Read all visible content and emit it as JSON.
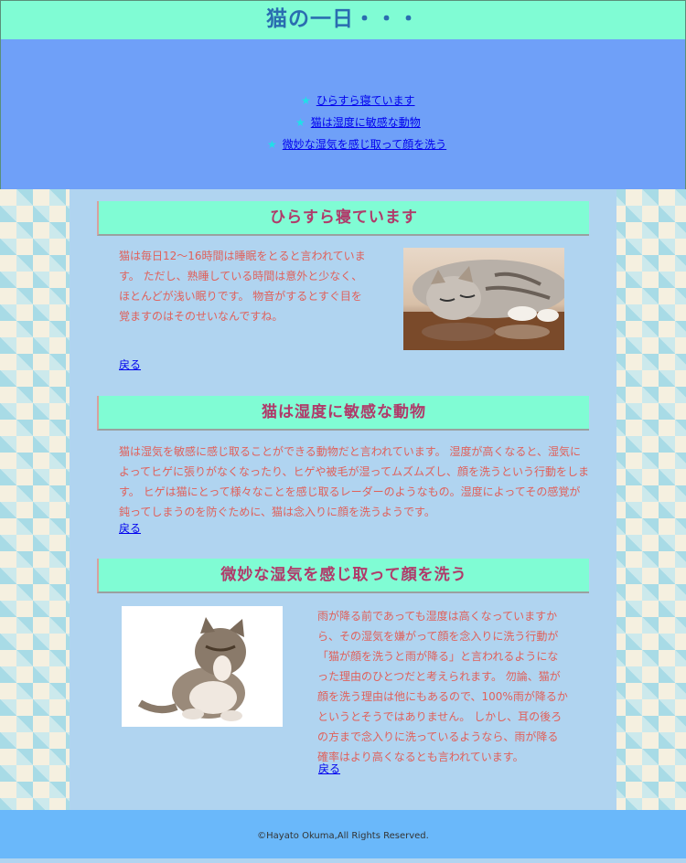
{
  "header": {
    "title": "猫の一日・・・"
  },
  "nav": {
    "bullet": "★",
    "items": [
      {
        "label": "ひらすら寝ています"
      },
      {
        "label": "猫は湿度に敏感な動物"
      },
      {
        "label": "微妙な湿気を感じ取って顔を洗う"
      }
    ]
  },
  "sections": [
    {
      "heading": "ひらすら寝ています",
      "text": "猫は毎日12～16時間は睡眠をとると言われていま す。 ただし、熟睡している時間は意外と少なく、ほとんどが浅い眠りです。 物音がするとすぐ目を覚ますのはそのせいなんですね。",
      "back": "戻る"
    },
    {
      "heading": "猫は湿度に敏感な動物",
      "text": "猫は湿気を敏感に感じ取ることができる動物だと言われています。 湿度が高くなると、湿気によってヒゲに張りがなくなったり、ヒゲや被毛が湿ってムズムズし、顔を洗うという行動をします。 ヒゲは猫にとって様々なことを感じ取るレーダーのようなもの。湿度によってその感覚が鈍ってしまうのを防ぐために、猫は念入りに顔を洗うようです。",
      "back": "戻る"
    },
    {
      "heading": "微妙な湿気を感じ取って顔を洗う",
      "text": "雨が降る前であっても湿度は高くなっていますから、その湿気を嫌がって顔を念入りに洗う行動が「猫が顔を洗うと雨が降る」と言われるようになった理由のひとつだと考えられます。 勿論、猫が顔を洗う理由は他にもあるので、100%雨が降るかというとそうではありません。 しかし、耳の後ろの方まで念入りに洗っているようなら、雨が降る確率はより高くなるとも言われています。",
      "back": "戻る"
    }
  ],
  "footer": {
    "copyright": "©Hayato Okuma,All Rights Reserved."
  }
}
